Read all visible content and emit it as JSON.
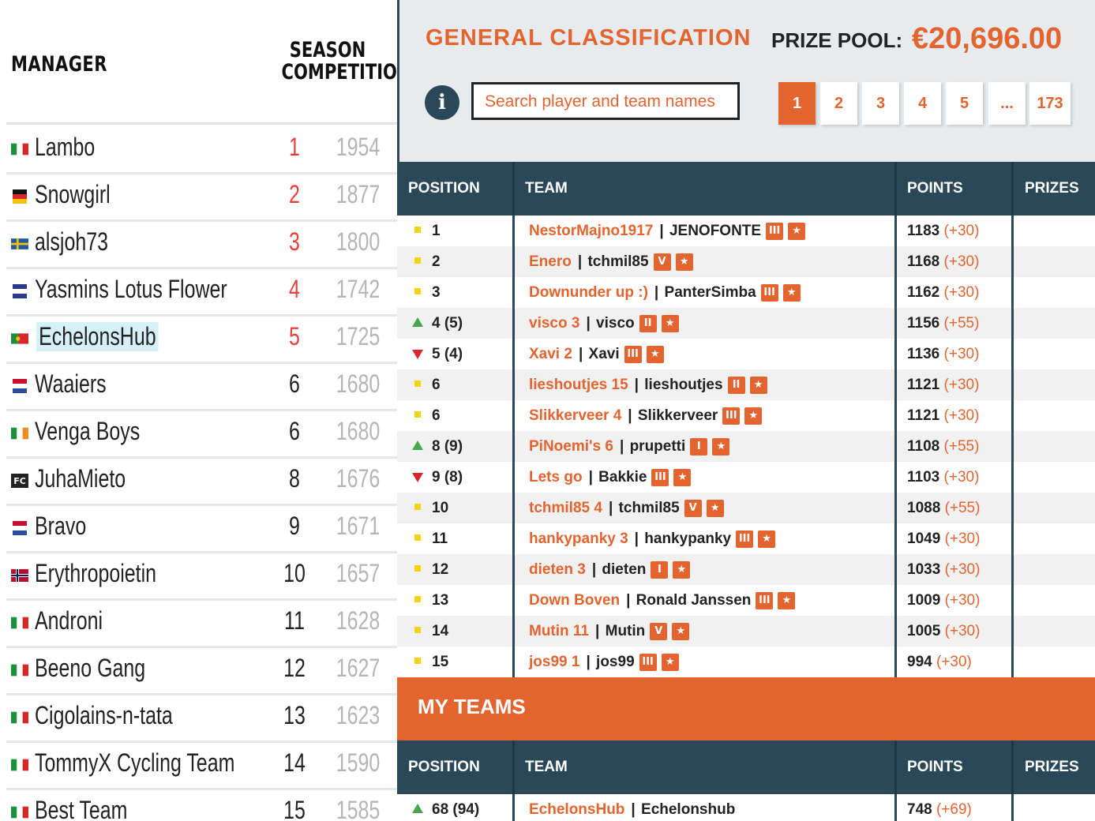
{
  "left": {
    "header_manager": "MANAGER",
    "header_season": "SEASON COMPETITION",
    "rows": [
      {
        "name": "Lambo",
        "rank": "1",
        "score": "1954",
        "flag": "italy",
        "highlight": false,
        "rank_red": true
      },
      {
        "name": "Snowgirl",
        "rank": "2",
        "score": "1877",
        "flag": "germany",
        "highlight": false,
        "rank_red": true
      },
      {
        "name": "alsjoh73",
        "rank": "3",
        "score": "1800",
        "flag": "sweden",
        "highlight": false,
        "rank_red": true
      },
      {
        "name": "Yasmins Lotus Flower",
        "rank": "4",
        "score": "1742",
        "flag": "unknown-blue",
        "highlight": false,
        "rank_red": true
      },
      {
        "name": "EchelonsHub",
        "rank": "5",
        "score": "1725",
        "flag": "portugal",
        "highlight": true,
        "rank_red": true
      },
      {
        "name": "Waaiers",
        "rank": "6",
        "score": "1680",
        "flag": "netherlands",
        "highlight": false,
        "rank_red": false
      },
      {
        "name": "Venga Boys",
        "rank": "6",
        "score": "1680",
        "flag": "ireland",
        "highlight": false,
        "rank_red": false
      },
      {
        "name": "JuhaMieto",
        "rank": "8",
        "score": "1676",
        "flag": "fc-badge",
        "highlight": false,
        "rank_red": false
      },
      {
        "name": "Bravo",
        "rank": "9",
        "score": "1671",
        "flag": "netherlands",
        "highlight": false,
        "rank_red": false
      },
      {
        "name": "Erythropoietin",
        "rank": "10",
        "score": "1657",
        "flag": "norway",
        "highlight": false,
        "rank_red": false
      },
      {
        "name": "Androni",
        "rank": "11",
        "score": "1628",
        "flag": "italy",
        "highlight": false,
        "rank_red": false
      },
      {
        "name": "Beeno Gang",
        "rank": "12",
        "score": "1627",
        "flag": "italy",
        "highlight": false,
        "rank_red": false
      },
      {
        "name": "Cigolains-n-tata",
        "rank": "13",
        "score": "1623",
        "flag": "italy",
        "highlight": false,
        "rank_red": false
      },
      {
        "name": "TommyX Cycling Team",
        "rank": "14",
        "score": "1590",
        "flag": "italy",
        "highlight": false,
        "rank_red": false
      },
      {
        "name": "Best Team",
        "rank": "15",
        "score": "1585",
        "flag": "italy",
        "highlight": false,
        "rank_red": false
      }
    ]
  },
  "right": {
    "title": "GENERAL CLASSIFICATION",
    "prize_pool_label": "PRIZE POOL:",
    "prize_pool_value": "€20,696.00",
    "info_icon": "i",
    "search_placeholder": "Search player and team names",
    "pages": [
      "1",
      "2",
      "3",
      "4",
      "5",
      "...",
      "173"
    ],
    "active_page": "1",
    "columns": {
      "position": "POSITION",
      "team": "TEAM",
      "points": "POINTS",
      "prizes": "PRIZES"
    },
    "rows": [
      {
        "pos": "1",
        "trend": "same",
        "team": "NestorMajno1917",
        "manager": "JENOFONTE",
        "badge": "III",
        "points": "1183",
        "delta": "(+30)"
      },
      {
        "pos": "2",
        "trend": "same",
        "team": "Enero",
        "manager": "tchmil85",
        "badge": "V",
        "points": "1168",
        "delta": "(+30)"
      },
      {
        "pos": "3",
        "trend": "same",
        "team": "Downunder up :)",
        "manager": "PanterSimba",
        "badge": "III",
        "points": "1162",
        "delta": "(+30)"
      },
      {
        "pos": "4 (5)",
        "trend": "up",
        "team": "visco 3",
        "manager": "visco",
        "badge": "II",
        "points": "1156",
        "delta": "(+55)"
      },
      {
        "pos": "5 (4)",
        "trend": "down",
        "team": "Xavi 2",
        "manager": "Xavi",
        "badge": "III",
        "points": "1136",
        "delta": "(+30)"
      },
      {
        "pos": "6",
        "trend": "same",
        "team": "lieshoutjes 15",
        "manager": "lieshoutjes",
        "badge": "II",
        "points": "1121",
        "delta": "(+30)"
      },
      {
        "pos": "6",
        "trend": "same",
        "team": "Slikkerveer 4",
        "manager": "Slikkerveer",
        "badge": "III",
        "points": "1121",
        "delta": "(+30)"
      },
      {
        "pos": "8 (9)",
        "trend": "up",
        "team": "PiNoemi's 6",
        "manager": "prupetti",
        "badge": "I",
        "points": "1108",
        "delta": "(+55)"
      },
      {
        "pos": "9 (8)",
        "trend": "down",
        "team": "Lets go",
        "manager": "Bakkie",
        "badge": "III",
        "points": "1103",
        "delta": "(+30)"
      },
      {
        "pos": "10",
        "trend": "same",
        "team": "tchmil85 4",
        "manager": "tchmil85",
        "badge": "V",
        "points": "1088",
        "delta": "(+55)"
      },
      {
        "pos": "11",
        "trend": "same",
        "team": "hankypanky 3",
        "manager": "hankypanky",
        "badge": "III",
        "points": "1049",
        "delta": "(+30)"
      },
      {
        "pos": "12",
        "trend": "same",
        "team": "dieten 3",
        "manager": "dieten",
        "badge": "I",
        "points": "1033",
        "delta": "(+30)"
      },
      {
        "pos": "13",
        "trend": "same",
        "team": "Down Boven",
        "manager": "Ronald Janssen",
        "badge": "III",
        "points": "1009",
        "delta": "(+30)"
      },
      {
        "pos": "14",
        "trend": "same",
        "team": "Mutin 11",
        "manager": "Mutin",
        "badge": "V",
        "points": "1005",
        "delta": "(+30)"
      },
      {
        "pos": "15",
        "trend": "same",
        "team": "jos99 1",
        "manager": "jos99",
        "badge": "III",
        "points": "994",
        "delta": "(+30)"
      }
    ],
    "my_teams_title": "MY TEAMS",
    "my_rows": [
      {
        "pos": "68 (94)",
        "trend": "up",
        "team": "EchelonsHub",
        "manager": "Echelonshub",
        "points": "748",
        "delta": "(+69)"
      }
    ]
  },
  "colors": {
    "accent": "#e3642f",
    "header": "#2a4857",
    "up": "#46a84b",
    "down": "#d9242a",
    "same": "#f4d40c"
  }
}
